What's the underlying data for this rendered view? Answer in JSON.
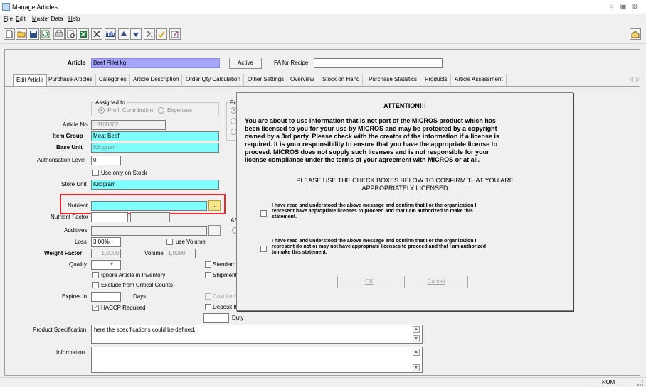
{
  "window": {
    "title": "Manage Articles",
    "controls": [
      "○",
      "▣",
      "⊠"
    ]
  },
  "menu": [
    "File",
    "Edit",
    "Master Data",
    "Help"
  ],
  "menu_mnemonics": [
    "F",
    "E",
    "M",
    "H"
  ],
  "toolbar": {
    "buttons": [
      "new-icon",
      "open-icon",
      "save-icon",
      "refresh-icon",
      "print-icon",
      "preview-icon",
      "excel-icon",
      "delete-icon",
      "info-icon",
      "up-icon",
      "down-icon",
      "tools-icon",
      "check-icon",
      "edit-icon"
    ],
    "info_label": "info"
  },
  "header": {
    "article_label": "Article",
    "article_value": "Beef Fillet kg",
    "active_button": "Active",
    "pa_recipe_label": "PA for Recipe:",
    "pa_recipe_value": ""
  },
  "tabs": [
    {
      "label": "Edit Article",
      "active": true
    },
    {
      "label": "Purchase Articles",
      "active": false
    },
    {
      "label": "Categories",
      "active": false
    },
    {
      "label": "Article Description",
      "active": false
    },
    {
      "label": "Order Qty Calculation",
      "active": false
    },
    {
      "label": "Other Settings",
      "active": false
    },
    {
      "label": "Overview",
      "active": false
    },
    {
      "label": "Stock on Hand",
      "active": false
    },
    {
      "label": "Purchase Statistics",
      "active": false
    },
    {
      "label": "Products",
      "active": false
    },
    {
      "label": "Article Assessment",
      "active": false
    }
  ],
  "tab_scroll": {
    "left": "◁",
    "right": "▷"
  },
  "form": {
    "assigned_to_label": "Assigned to",
    "profit_contribution": "Profit Contribution",
    "expenses": "Expenses",
    "pr_partial": "Pr",
    "article_no_label": "Article No.",
    "article_no_value": "10100002",
    "item_group_label": "Item Group",
    "item_group_value": "Meat Beef",
    "base_unit_label": "Base Unit",
    "base_unit_value": "Kilogram",
    "auth_level_label": "Authorisation Level",
    "auth_level_value": "0",
    "use_only_on_stock": "Use only on Stock",
    "store_unit_label": "Store Unit",
    "store_unit_value": "Kilogram",
    "nutrient_label": "Nutrient",
    "nutrient_value": "",
    "browse_label": "...",
    "nutrient_factor_label": "Nutrient Factor",
    "ae_partial": "AE",
    "additives_label": "Additives",
    "loss_label": "Loss",
    "loss_value": "3,00%",
    "use_volume": "use Volume",
    "weight_factor_label": "Weight Factor",
    "weight_factor_value": "1,0000",
    "volume_label": "Volume",
    "volume_value": "1,0000",
    "quality_label": "Quality",
    "quality_arrow": "▾",
    "standard_partial": "Standard",
    "ignore_inventory": "Ignore Article in Inventory",
    "shipment_partial": "Shipment",
    "exclude_critical": "Exclude from Critical Counts",
    "expires_in_label": "Expires in",
    "days_label": "Days",
    "cost_item_partial": "Cost Item",
    "haccp_label": "HACCP Required",
    "deposit_partial": "Deposit It",
    "duty_label": "Duty",
    "product_spec_label": "Product Specification",
    "product_spec_value": "here the specifications could be defined.",
    "information_label": "Information",
    "information_value": "",
    "scroll_up": "▲",
    "scroll_down": "▼"
  },
  "dialog": {
    "title": "ATTENTION!!!",
    "message": [
      "You are about to use information that is not part of the MICROS product which has",
      "been licensed to you for your use by MICROS and may be protected by a copyright",
      "owned by a 3rd party. Please check with the creator of the information if a license is",
      "required. It is your responsibility to ensure that you have the appropriate license to",
      "proceed. MICROS does not supply such licenses and is not responsible for your",
      "license compliance under the terms of your agreement with MICROS or at all."
    ],
    "confirm_heading": [
      "PLEASE USE THE CHECK BOXES BELOW TO CONFIRM THAT YOU ARE",
      "APPROPRIATELY LICENSED"
    ],
    "option1": [
      "I have read and understood the above message and confirm that I or the organization I",
      "represent have appropriate licenses to proceed and that I am authorized to make this",
      "statement."
    ],
    "option2": [
      "I have read and understood the above message and confirm that I or the organization I",
      "represent do not or may not have appropriate licenses to proceed and that I am authorized",
      "to make this statement."
    ],
    "ok_label": "OK",
    "cancel_label": "Cancel"
  },
  "status": {
    "num": "NUM"
  },
  "colors": {
    "required_field": "#80ffff",
    "article_field": "#a6a6ff",
    "highlight_box": "#e8292f"
  }
}
